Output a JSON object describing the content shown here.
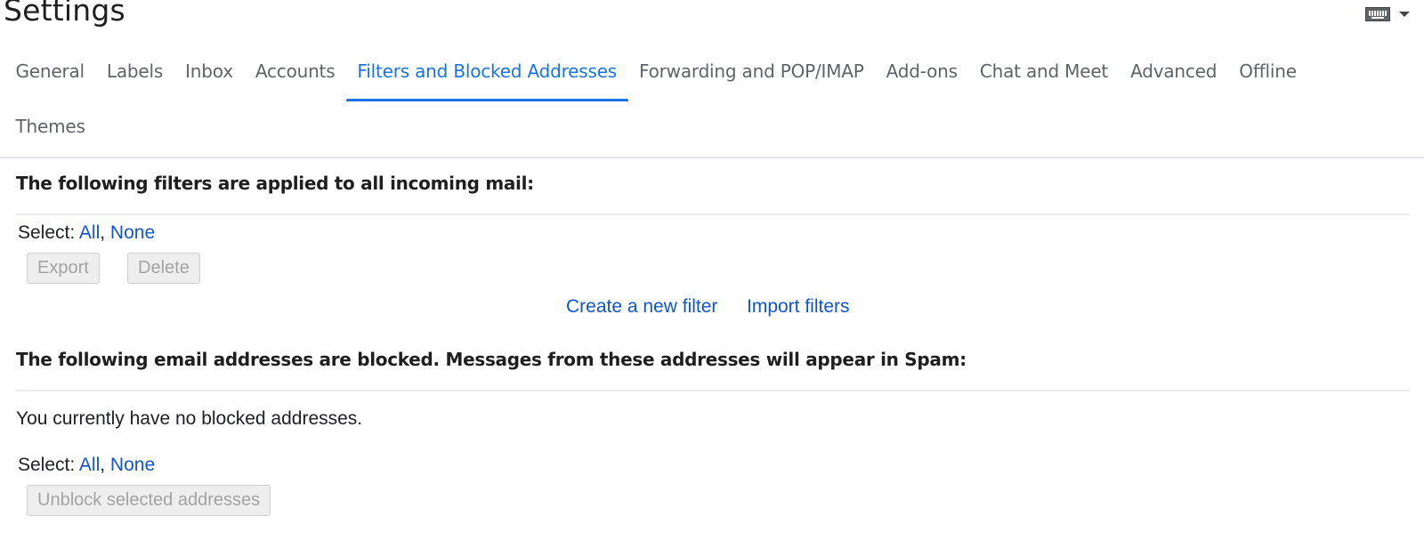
{
  "header": {
    "title": "Settings",
    "input_tools_icon": "keyboard-icon",
    "input_tools_menu_icon": "caret-down-icon"
  },
  "tabs": [
    {
      "label": "General",
      "active": false
    },
    {
      "label": "Labels",
      "active": false
    },
    {
      "label": "Inbox",
      "active": false
    },
    {
      "label": "Accounts",
      "active": false
    },
    {
      "label": "Filters and Blocked Addresses",
      "active": true
    },
    {
      "label": "Forwarding and POP/IMAP",
      "active": false
    },
    {
      "label": "Add-ons",
      "active": false
    },
    {
      "label": "Chat and Meet",
      "active": false
    },
    {
      "label": "Advanced",
      "active": false
    },
    {
      "label": "Offline",
      "active": false
    },
    {
      "label": "Themes",
      "active": false
    }
  ],
  "filters": {
    "heading": "The following filters are applied to all incoming mail:",
    "select_label": "Select:",
    "select_all": "All",
    "separator": ",",
    "select_none": "None",
    "export_button": "Export",
    "delete_button": "Delete",
    "create_filter_link": "Create a new filter",
    "import_filters_link": "Import filters"
  },
  "blocked": {
    "heading": "The following email addresses are blocked. Messages from these addresses will appear in Spam:",
    "empty_message": "You currently have no blocked addresses.",
    "select_label": "Select:",
    "select_all": "All",
    "separator": ",",
    "select_none": "None",
    "unblock_button": "Unblock selected addresses"
  },
  "colors": {
    "accent": "#1a73e8",
    "link": "#1155cc",
    "tab_text": "#5f6368",
    "disabled_button_bg": "#eeeeee",
    "disabled_button_text": "#a3a3a3"
  }
}
